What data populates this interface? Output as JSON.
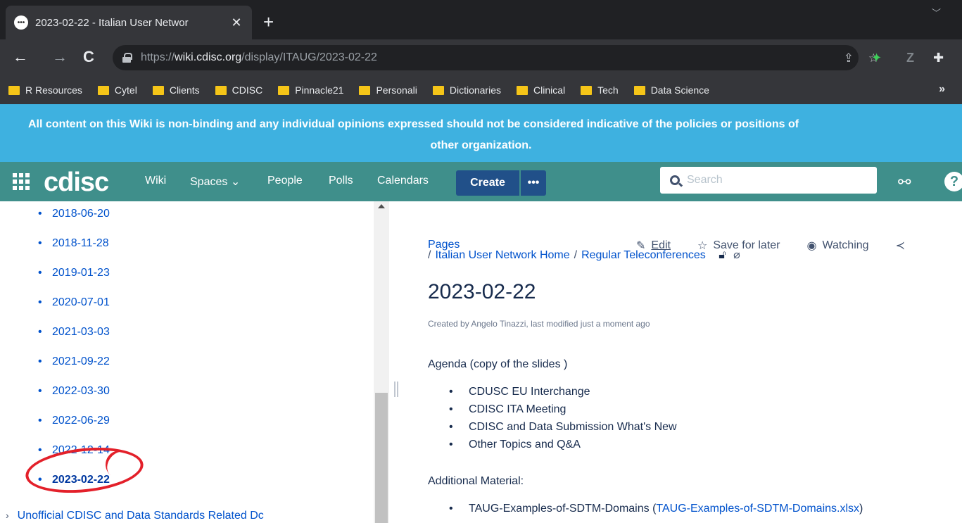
{
  "browser": {
    "tab_title": "2023-02-22 - Italian User Networ",
    "new_tab": "+",
    "url_prefix": "https://",
    "url_host": "wiki.cdisc.org",
    "url_path": "/display/ITAUG/2023-02-22",
    "bookmarks": [
      "R Resources",
      "Cytel",
      "Clients",
      "CDISC",
      "Pinnacle21",
      "Personali",
      "Dictionaries",
      "Clinical",
      "Tech",
      "Data Science"
    ],
    "bookmarks_more": "»"
  },
  "banner": {
    "line1": "All content on this Wiki is non-binding and any individual opinions expressed should not be considered indicative of the policies or positions of",
    "line2": "other organization."
  },
  "appbar": {
    "logo": "cdisc",
    "nav": [
      "Wiki",
      "Spaces ⌄",
      "People",
      "Polls",
      "Calendars"
    ],
    "create": "Create",
    "more": "•••",
    "search_placeholder": "Search"
  },
  "sidebar": {
    "items": [
      "2018-06-20",
      "2018-11-28",
      "2019-01-23",
      "2020-07-01",
      "2021-03-03",
      "2021-09-22",
      "2022-03-30",
      "2022-06-29",
      "2022-12-14",
      "2023-02-22"
    ],
    "more_label": "Unofficial CDISC and Data Standards Related Dc"
  },
  "main": {
    "pages": "Pages",
    "actions": {
      "edit": "Edit",
      "save": "Save for later",
      "watching": "Watching"
    },
    "crumbs": [
      "Italian User Network Home",
      "Regular Teleconferences"
    ],
    "title": "2023-02-22",
    "byline": "Created by Angelo Tinazzi, last modified just a moment ago",
    "agenda": "Agenda (copy of the slides )",
    "agenda_items": [
      "CDUSC EU Interchange",
      "CDISC ITA Meeting",
      "CDISC and Data Submission What's New",
      "Other Topics and Q&A"
    ],
    "additional": "Additional Material:",
    "material_item": "TAUG-Examples-of-SDTM-Domains (",
    "material_link": "TAUG-Examples-of-SDTM-Domains.xlsx",
    "material_close": ")"
  }
}
